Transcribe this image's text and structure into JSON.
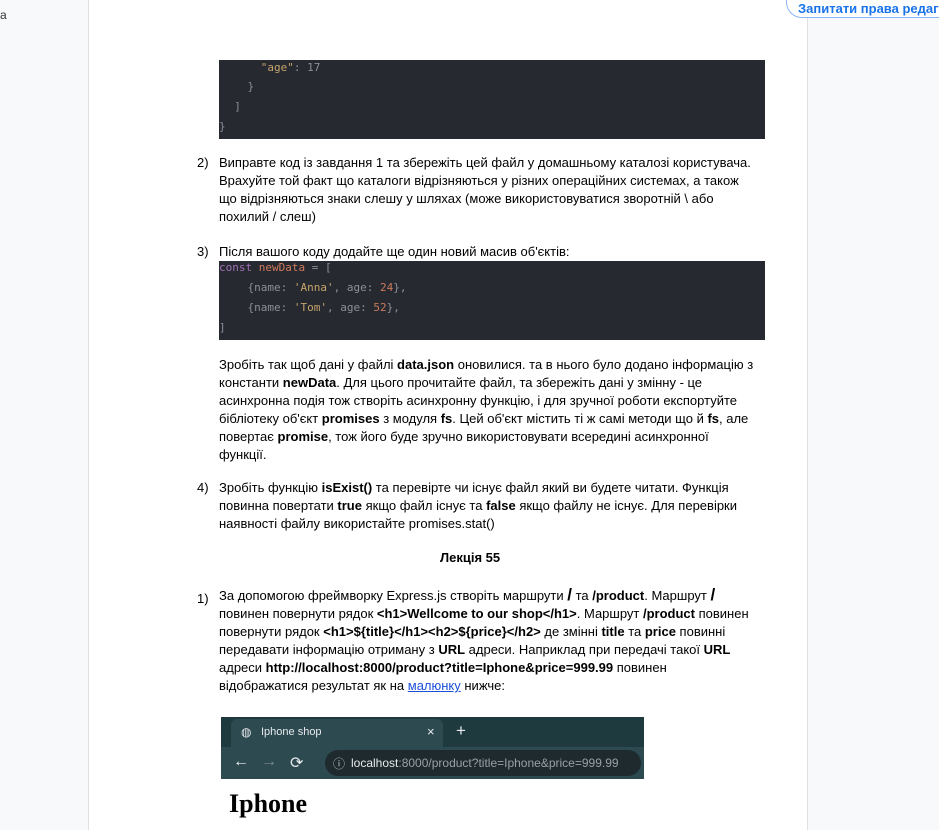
{
  "top_left_char": "а",
  "request_button": "Запитати права редагу",
  "code1": {
    "lines": [
      {
        "indent": "      ",
        "key": "\"age\"",
        "rest": ": 17"
      },
      {
        "indent": "    ",
        "key": "",
        "rest": "}"
      },
      {
        "indent": "  ",
        "key": "",
        "rest": "]"
      },
      {
        "indent": "",
        "key": "",
        "rest": "}"
      }
    ]
  },
  "task2": {
    "number": "2)",
    "lines": [
      "Виправте код із завдання 1 та збережіть цей файл у домашньому каталозі користувача.",
      "Врахуйте той факт що каталоги відрізняються у різних операційних системах, а також",
      "що відрізняються знаки слешу у шляхах (може використовуватися зворотній \\ або",
      "похилий / слеш)"
    ]
  },
  "task3": {
    "number": "3)",
    "intro": "Після вашого коду додайте ще один новий масив об'єктів:"
  },
  "code2": {
    "line1_kw": "const",
    "line1_var": "newData",
    "line1_rest": " = [",
    "line2_a": "    {name: ",
    "line2_str": "'Anna'",
    "line2_b": ", age: ",
    "line2_num": "24",
    "line2_c": "},",
    "line3_a": "    {name: ",
    "line3_str": "'Tom'",
    "line3_b": ", age: ",
    "line3_num": "52",
    "line3_c": "},",
    "line4": "]"
  },
  "task3_text": {
    "l1_a": "Зробіть так щоб дані у файлі ",
    "l1_b": "data.json",
    "l1_c": " оновилися. та в нього було додано інформацію з",
    "l2_a": "константи ",
    "l2_b": "newData",
    "l2_c": ". Для цього прочитайте файл, та збережіть дані у змінну - це",
    "l3": "асинхронна подія тож створіть асинхронну функцію, і для зручної роботи експортуйте",
    "l4_a": "бібліотеку об'єкт ",
    "l4_b": "promises",
    "l4_c": " з модуля ",
    "l4_d": "fs",
    "l4_e": ". Цей об'єкт містить ті ж самі методи що й ",
    "l4_f": "fs",
    "l4_g": ", але",
    "l5_a": "повертає ",
    "l5_b": "promise",
    "l5_c": ", тож його буде зручно використовувати всередині асинхронної",
    "l6": "функції."
  },
  "task4": {
    "number": "4)",
    "l1_a": "Зробіть функцію ",
    "l1_b": "isExist()",
    "l1_c": " та перевірте чи існує файл який ви будете читати. Функція",
    "l2_a": "повинна повертати ",
    "l2_b": "true",
    "l2_c": " якщо файл існує та ",
    "l2_d": "false",
    "l2_e": " якщо файлу не існує. Для перевірки",
    "l3": "наявності файлу використайте promises.stat()"
  },
  "lecture_title": "Лекція 55",
  "task5": {
    "number": "1)",
    "l1_a": "За допомогою фреймворку Express.js створіть маршрути ",
    "l1_slash1": "/",
    "l1_b": " та ",
    "l1_c": "/product",
    "l1_d": ". Маршрут ",
    "l1_slash2": "/",
    "l2_a": "повинен повернути рядок ",
    "l2_b": "<h1>Wellcome to our shop</h1>",
    "l2_c": ". Маршрут  ",
    "l2_d": "/product",
    "l2_e": " повинен",
    "l3_a": "повернути рядок ",
    "l3_b": "<h1>${title}</h1><h2>${price}</h2>",
    "l3_c": " де змінні ",
    "l3_d": "title",
    "l3_e": " та ",
    "l3_f": "price",
    "l3_g": " повинні",
    "l4_a": "передавати інформацію отриману з ",
    "l4_b": "URL",
    "l4_c": " адреси. Наприклад при передачі такої ",
    "l4_d": "URL",
    "l5_a": "адреси ",
    "l5_b": "http://localhost:8000/product?title=Iphone&price=999.99",
    "l5_c": " повинен",
    "l6_a": "відображатися результат як на ",
    "l6_link": "малюнку",
    "l6_b": " нижче:"
  },
  "browser": {
    "tab_title": "Iphone shop",
    "close": "×",
    "plus": "+",
    "back": "←",
    "forward": "→",
    "reload": "⟳",
    "info": "ⓘ",
    "host": "localhost",
    "path": ":8000/product?title=Iphone&price=999.99",
    "globe": "◍"
  },
  "result_heading": "Iphone"
}
